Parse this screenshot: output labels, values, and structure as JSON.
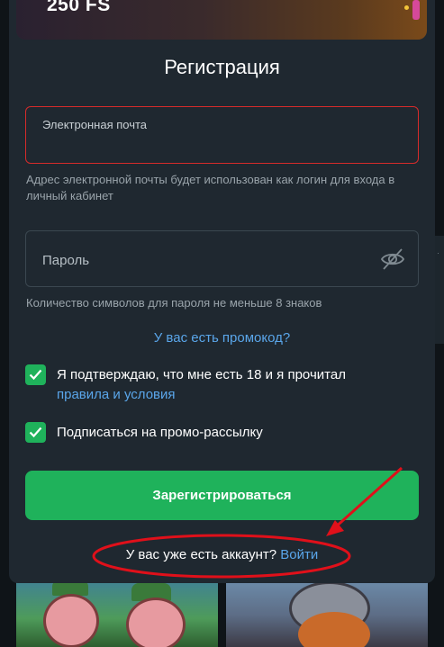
{
  "banner": {
    "text": "250 FS"
  },
  "form": {
    "title": "Регистрация",
    "email": {
      "label": "Электронная почта",
      "value": ""
    },
    "email_hint": "Адрес электронной почты будет использован как логин для входа в личный кабинет",
    "password": {
      "placeholder": "Пароль",
      "value": ""
    },
    "password_hint": "Количество символов для пароля не меньше 8 знаков",
    "promo_link": "У вас есть промокод?",
    "age_confirm": {
      "checked": true,
      "text": "Я подтверждаю, что мне есть 18 и я прочитал",
      "link": "правила и условия"
    },
    "newsletter": {
      "checked": true,
      "text": "Подписаться на промо-рассылку"
    },
    "register_button": "Зарегистрироваться",
    "have_account_text": "У вас уже есть аккаунт?",
    "login_link": "Войти"
  },
  "colors": {
    "accent_green": "#1fb25b",
    "link_blue": "#5aa6ea",
    "error_red": "#d62b2b",
    "annotation_red": "#e0101a",
    "modal_bg": "#1f2830"
  },
  "icons": [
    "eye-off-icon",
    "checkmark-icon"
  ]
}
